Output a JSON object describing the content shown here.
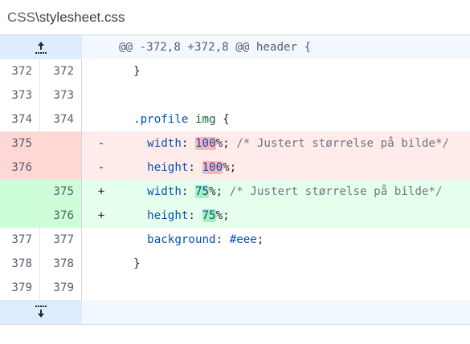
{
  "file": {
    "folder": "CSS",
    "separator": "\\",
    "name": "stylesheet.css"
  },
  "hunk_header": "@@ -372,8 +372,8 @@ header {",
  "rows": [
    {
      "type": "ctx",
      "old": "372",
      "new": "372",
      "marker": "",
      "text": "}"
    },
    {
      "type": "ctx",
      "old": "373",
      "new": "373",
      "marker": "",
      "text": ""
    },
    {
      "type": "ctx",
      "old": "374",
      "new": "374",
      "marker": "",
      "sel": ".profile",
      "tag": "img",
      "rest": " {"
    },
    {
      "type": "del",
      "old": "375",
      "new": "",
      "marker": "-",
      "prop": "width",
      "val": "100",
      "unit": "%;",
      "comment": " /* Justert størrelse på bilde*/"
    },
    {
      "type": "del",
      "old": "376",
      "new": "",
      "marker": "-",
      "prop": "height",
      "val": "100",
      "unit": "%;",
      "comment": ""
    },
    {
      "type": "add",
      "old": "",
      "new": "375",
      "marker": "+",
      "prop": "width",
      "val": "75",
      "unit": "%;",
      "comment": " /* Justert størrelse på bilde*/"
    },
    {
      "type": "add",
      "old": "",
      "new": "376",
      "marker": "+",
      "prop": "height",
      "val": "75",
      "unit": "%;",
      "comment": ""
    },
    {
      "type": "ctx",
      "old": "377",
      "new": "377",
      "marker": "",
      "prop": "background",
      "hex": "#eee",
      "unit": ";"
    },
    {
      "type": "ctx",
      "old": "378",
      "new": "378",
      "marker": "",
      "text": "}"
    },
    {
      "type": "ctx",
      "old": "379",
      "new": "379",
      "marker": "",
      "text": ""
    }
  ],
  "colors": {
    "added_bg": "#e6ffec",
    "deleted_bg": "#ffebe9",
    "hunk_bg": "#f1f8ff"
  },
  "icons": {
    "expand_up": "expand-up-icon",
    "expand_down": "expand-down-icon"
  }
}
